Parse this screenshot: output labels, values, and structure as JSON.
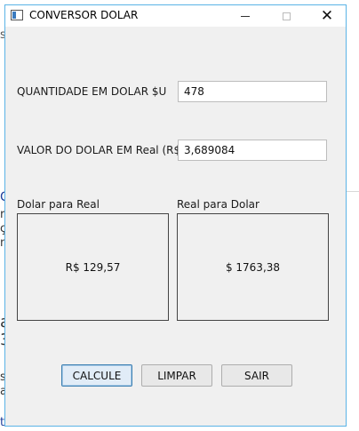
{
  "background": {
    "fragments": [
      "s,",
      "C",
      "ro",
      "ça",
      "nv",
      "a",
      "3",
      "se",
      "a",
      "te"
    ]
  },
  "window": {
    "title": "CONVERSOR DOLAR",
    "icon": "app-window-icon",
    "controls": [
      "minimize-icon",
      "maximize-icon",
      "close-icon"
    ]
  },
  "form": {
    "quantity_label": "QUANTIDADE EM DOLAR $U",
    "quantity_value": "478",
    "rate_label": "VALOR DO DOLAR EM Real (R$)",
    "rate_value": "3,689084"
  },
  "results": {
    "dolar_para_real_label": "Dolar para Real",
    "dolar_para_real_value": "R$ 129,57",
    "real_para_dolar_label": "Real para Dolar",
    "real_para_dolar_value": "$ 1763,38"
  },
  "buttons": {
    "calcule": "CALCULE",
    "limpar": "LIMPAR",
    "sair": "SAIR"
  },
  "colors": {
    "window_border": "#5ab3e6",
    "window_bg": "#f0f0f0",
    "default_button_border": "#3c7fb1"
  }
}
